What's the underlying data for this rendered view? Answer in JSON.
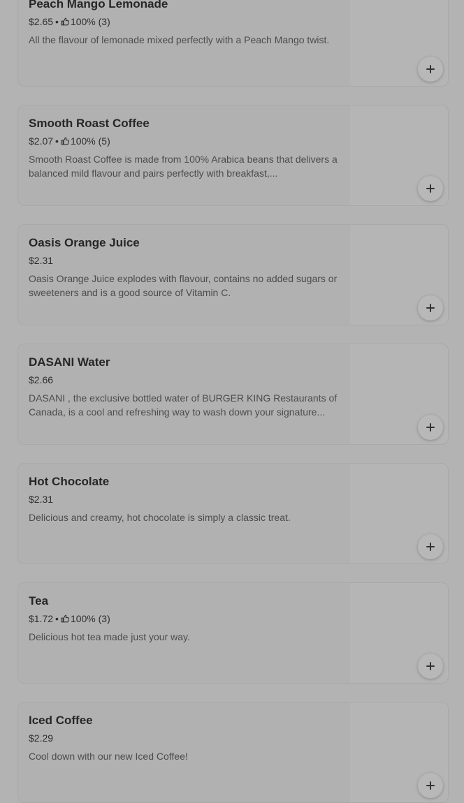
{
  "menu": {
    "items": [
      {
        "name": "Peach Mango Lemonade",
        "price": "$2.65",
        "rating": "100% (3)",
        "description": "All the flavour of lemonade mixed perfectly with a Peach Mango twist."
      },
      {
        "name": "Smooth Roast Coffee",
        "price": "$2.07",
        "rating": "100% (5)",
        "description": "Smooth Roast Coffee is made from 100% Arabica beans that delivers a balanced mild flavour and pairs perfectly with breakfast,..."
      },
      {
        "name": "Oasis Orange Juice",
        "price": "$2.31",
        "rating": null,
        "description": "Oasis Orange Juice explodes with flavour, contains no added sugars or sweeteners and is a good source of Vitamin C."
      },
      {
        "name": "DASANI Water",
        "price": "$2.66",
        "rating": null,
        "description": "DASANI , the exclusive bottled water of BURGER KING Restaurants of Canada, is a cool and refreshing way to wash down your signature..."
      },
      {
        "name": "Hot Chocolate",
        "price": "$2.31",
        "rating": null,
        "description": "Delicious and creamy, hot chocolate is simply a classic treat."
      },
      {
        "name": "Tea",
        "price": "$1.72",
        "rating": "100% (3)",
        "description": "Delicious hot tea made just your way."
      },
      {
        "name": "Iced Coffee",
        "price": "$2.29",
        "rating": null,
        "description": "Cool down with our new Iced Coffee!"
      }
    ],
    "separator": "•",
    "rating_icon": "thumbs-up-icon",
    "add_icon": "plus-icon"
  }
}
